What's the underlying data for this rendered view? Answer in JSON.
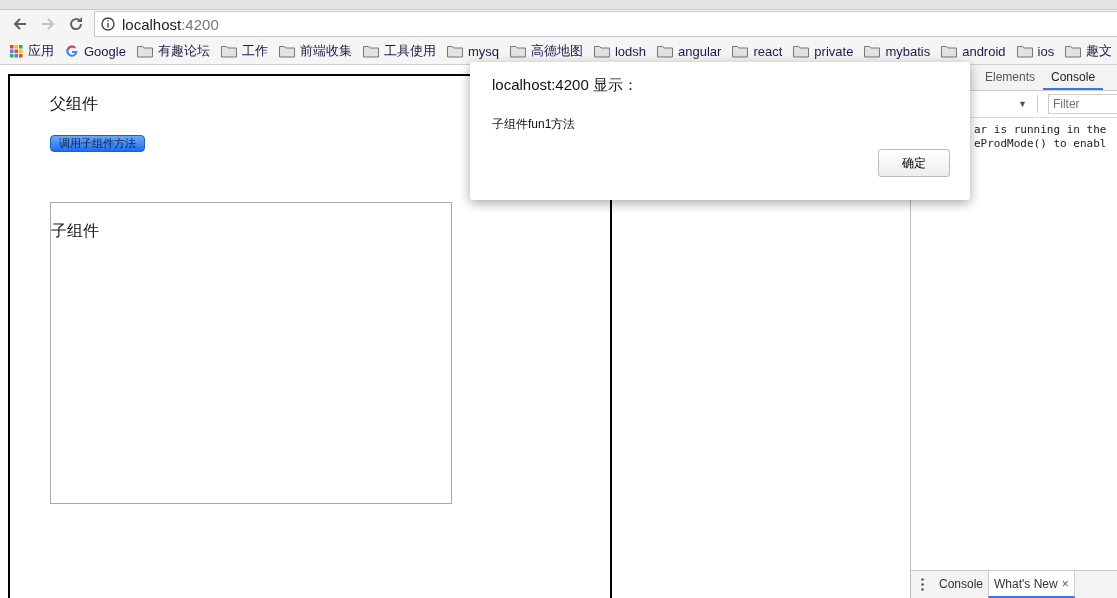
{
  "browser": {
    "nav": [
      {
        "kind": "back",
        "disabled": false
      },
      {
        "kind": "forward",
        "disabled": true
      },
      {
        "kind": "reload",
        "disabled": false
      }
    ],
    "address": {
      "host": "localhost",
      "port": ":4200"
    },
    "bookmarks": [
      {
        "label": "应用",
        "kind": "apps"
      },
      {
        "label": "Google",
        "kind": "google"
      },
      {
        "label": "有趣论坛",
        "kind": "folder"
      },
      {
        "label": "工作",
        "kind": "folder"
      },
      {
        "label": "前端收集",
        "kind": "folder"
      },
      {
        "label": "工具使用",
        "kind": "folder"
      },
      {
        "label": "mysq",
        "kind": "folder"
      },
      {
        "label": "高德地图",
        "kind": "folder"
      },
      {
        "label": "lodsh",
        "kind": "folder"
      },
      {
        "label": "angular",
        "kind": "folder"
      },
      {
        "label": "react",
        "kind": "folder"
      },
      {
        "label": "private",
        "kind": "folder"
      },
      {
        "label": "mybatis",
        "kind": "folder"
      },
      {
        "label": "android",
        "kind": "folder"
      },
      {
        "label": "ios",
        "kind": "folder"
      },
      {
        "label": "趣文",
        "kind": "folder"
      }
    ]
  },
  "page": {
    "parent_title": "父组件",
    "button": "调用子组件方法",
    "child_title": "子组件"
  },
  "dialog": {
    "title": "localhost:4200 显示：",
    "message": "子组件fun1方法",
    "ok_button": "确定"
  },
  "devtools": {
    "tabs": [
      {
        "label": "Elements",
        "selected": false
      },
      {
        "label": "Console",
        "selected": true
      }
    ],
    "context_arrow": "▼",
    "filter_placeholder": "Filter",
    "console_lines": [
      "ar is running in the",
      "eProdMode() to enabl"
    ],
    "drawer_tabs": [
      {
        "label": "Console",
        "selected": false
      },
      {
        "label": "What's New",
        "selected": true,
        "close": "×"
      }
    ]
  }
}
